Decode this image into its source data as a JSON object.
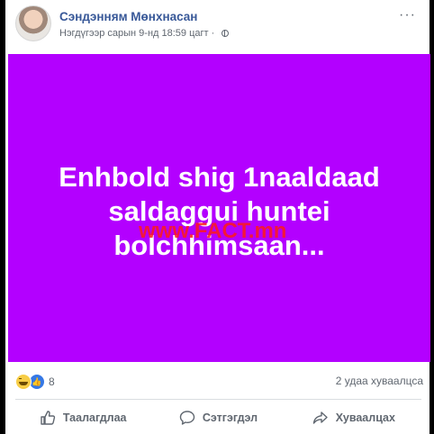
{
  "post": {
    "author": "Сэндэнням Мөнхнасан",
    "timestamp": "Нэгдүгээр сарын 9-нд 18:59 цагт",
    "separator": "·",
    "more_label": "···"
  },
  "image": {
    "background_color": "#b300ff",
    "lines": [
      "Enhbold shig 1naaldaad",
      "saldaggui huntei",
      "bolchhimsaan..."
    ],
    "watermark": "www.FACT.mn"
  },
  "reactions": {
    "icons": [
      "haha-icon",
      "like-icon"
    ],
    "count": "8",
    "shares": "2 удаа хуваалцса"
  },
  "actions": {
    "like_label": "Таалагдлаа",
    "comment_label": "Сэтгэгдэл",
    "share_label": "Хуваалцах"
  }
}
